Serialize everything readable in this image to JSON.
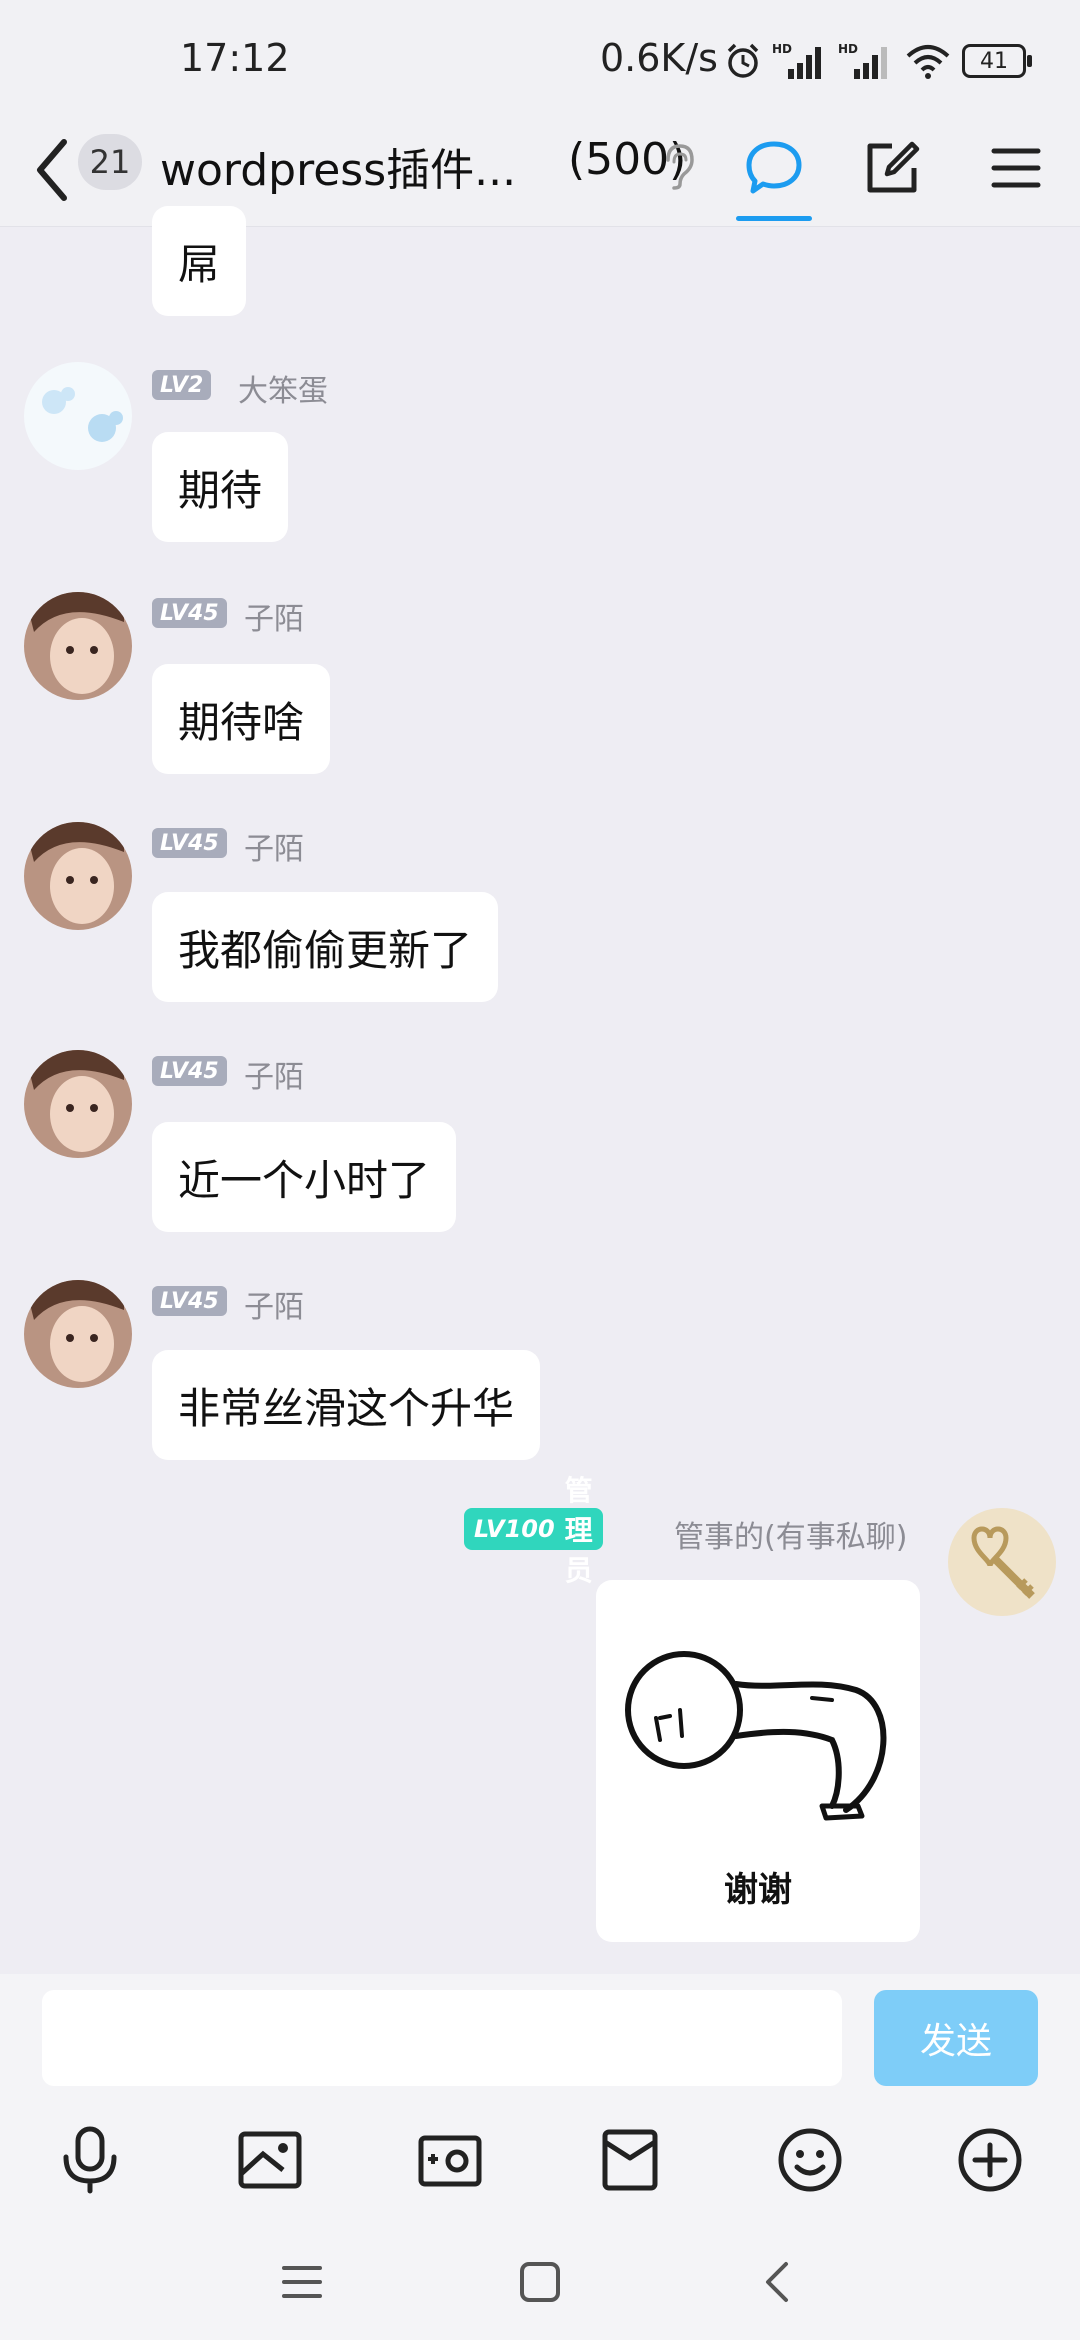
{
  "status_bar": {
    "time": "17:12",
    "network_speed": "0.6K/s",
    "battery": "41"
  },
  "header": {
    "unread_count": "21",
    "group_title": "wordpress插件...",
    "member_count": "(500)"
  },
  "messages": [
    {
      "text": "屌"
    },
    {
      "level": "LV2",
      "nickname": "大笨蛋",
      "text": "期待"
    },
    {
      "level": "LV45",
      "nickname": "子陌",
      "text": "期待啥"
    },
    {
      "level": "LV45",
      "nickname": "子陌",
      "text": "我都偷偷更新了"
    },
    {
      "level": "LV45",
      "nickname": "子陌",
      "text": "近一个小时了"
    },
    {
      "level": "LV45",
      "nickname": "子陌",
      "text": "非常丝滑这个升华"
    }
  ],
  "admin_message": {
    "level": "LV100",
    "role": "管理员",
    "nickname": "管事的(有事私聊)",
    "sticker_caption": "谢谢"
  },
  "input": {
    "value": "",
    "send_label": "发送"
  },
  "colors": {
    "accent": "#1c9cf0",
    "send_button": "#7ecdf8",
    "admin_tag": "#30d6bd",
    "level_tag": "#a8acbb"
  }
}
